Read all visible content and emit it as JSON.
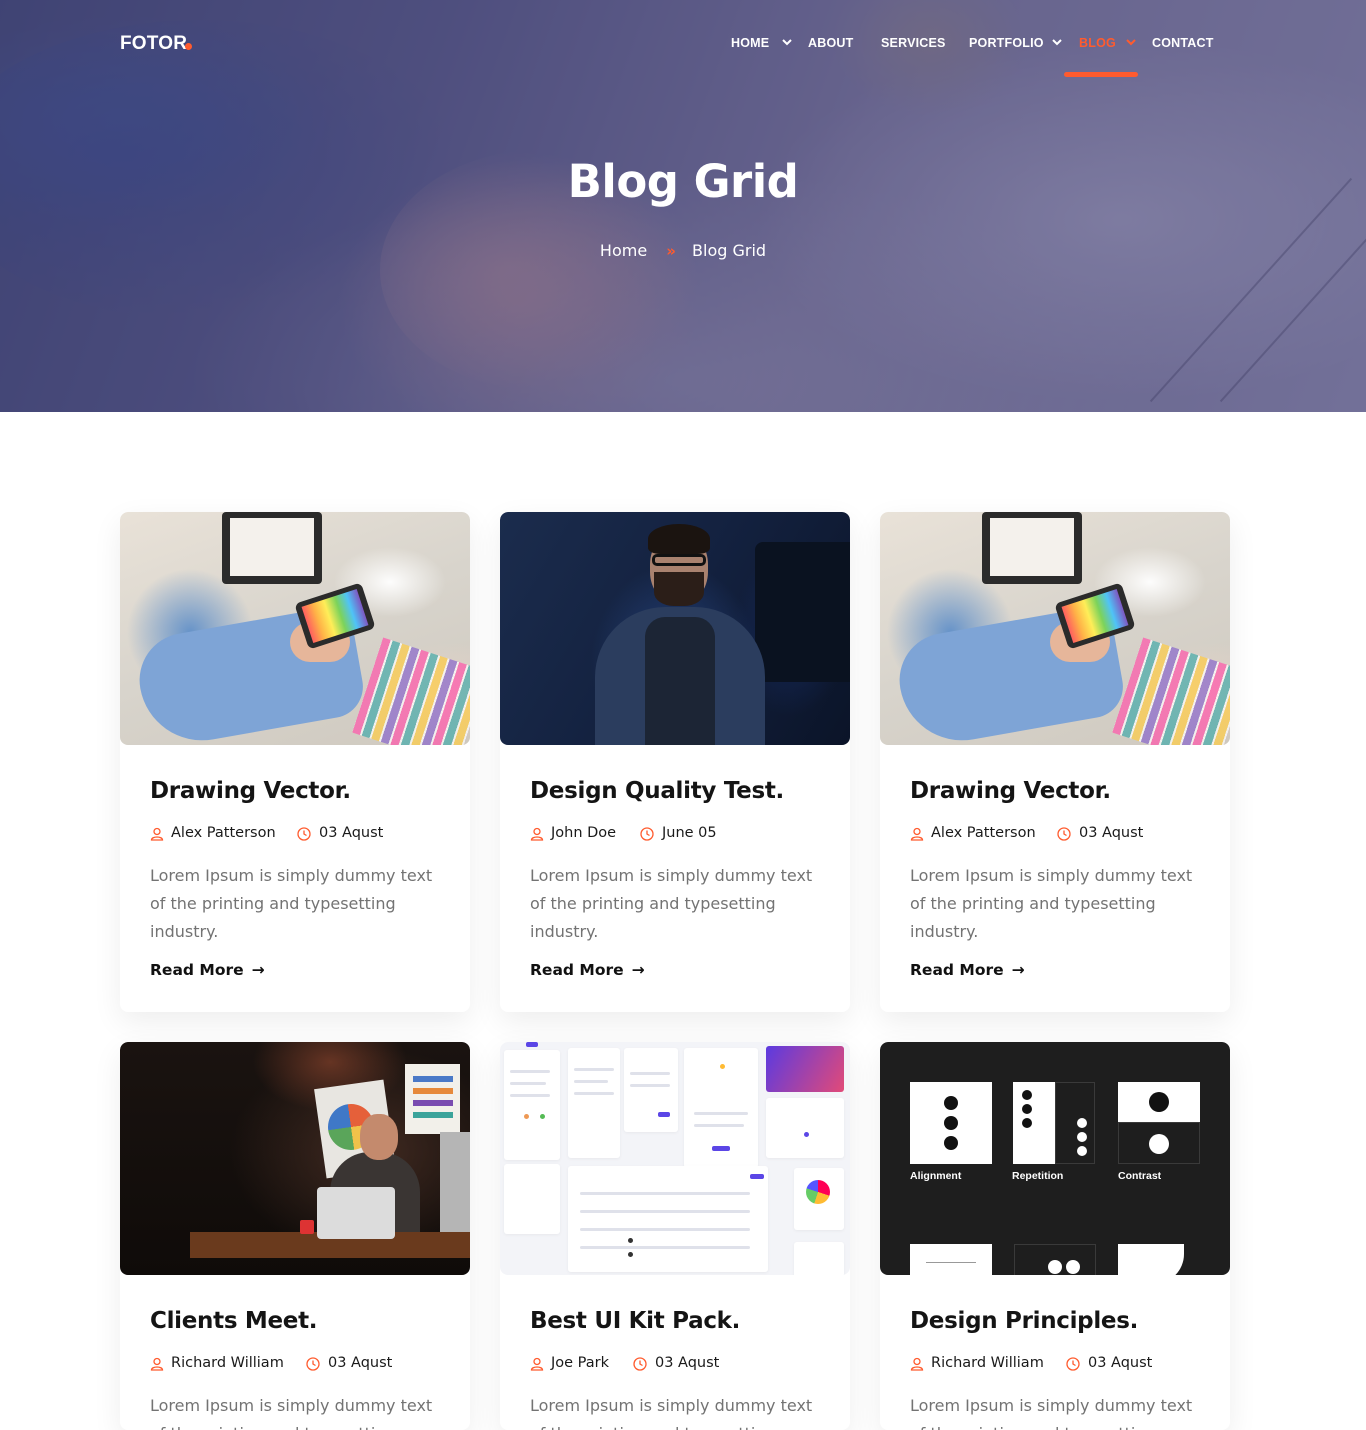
{
  "brand": {
    "logo": "FOTOR",
    "accent_color": "#ff5b2e"
  },
  "nav": {
    "items": [
      {
        "label": "HOME",
        "has_dropdown": true,
        "active": false
      },
      {
        "label": "ABOUT",
        "has_dropdown": false,
        "active": false
      },
      {
        "label": "SERVICES",
        "has_dropdown": false,
        "active": false
      },
      {
        "label": "PORTFOLIO",
        "has_dropdown": true,
        "active": false
      },
      {
        "label": "BLOG",
        "has_dropdown": true,
        "active": true
      },
      {
        "label": "CONTACT",
        "has_dropdown": false,
        "active": false
      }
    ]
  },
  "hero": {
    "title": "Blog Grid",
    "breadcrumb": {
      "home": "Home",
      "separator": "»",
      "current": "Blog Grid"
    }
  },
  "posts": [
    {
      "title": "Drawing Vector.",
      "author": "Alex Patterson",
      "date": "03 Aqust",
      "excerpt": "Lorem Ipsum is simply dummy text of the printing and typesetting industry.",
      "read_more": "Read More",
      "image": "designer-with-tablet"
    },
    {
      "title": "Design Quality Test.",
      "author": "John Doe",
      "date": "June 05",
      "excerpt": "Lorem Ipsum is simply dummy text of the printing and typesetting industry.",
      "read_more": "Read More",
      "image": "man-thinking-at-desk"
    },
    {
      "title": "Drawing Vector.",
      "author": "Alex Patterson",
      "date": "03 Aqust",
      "excerpt": "Lorem Ipsum is simply dummy text of the printing and typesetting industry.",
      "read_more": "Read More",
      "image": "designer-with-tablet"
    },
    {
      "title": "Clients Meet.",
      "author": "Richard William",
      "date": "03 Aqust",
      "excerpt": "Lorem Ipsum is simply dummy text of the printing and typesetting",
      "image": "man-with-laptop-dark-room"
    },
    {
      "title": "Best UI Kit Pack.",
      "author": "Joe Park",
      "date": "03 Aqust",
      "excerpt": "Lorem Ipsum is simply dummy text of the printing and typesetting",
      "image": "ui-kit-screens"
    },
    {
      "title": "Design Principles.",
      "author": "Richard William",
      "date": "03 Aqust",
      "excerpt": "Lorem Ipsum is simply dummy text of the printing and typesetting",
      "image": "design-principles-tiles"
    }
  ],
  "principles_image": {
    "labels": [
      "Alignment",
      "Repetition",
      "Contrast"
    ]
  }
}
